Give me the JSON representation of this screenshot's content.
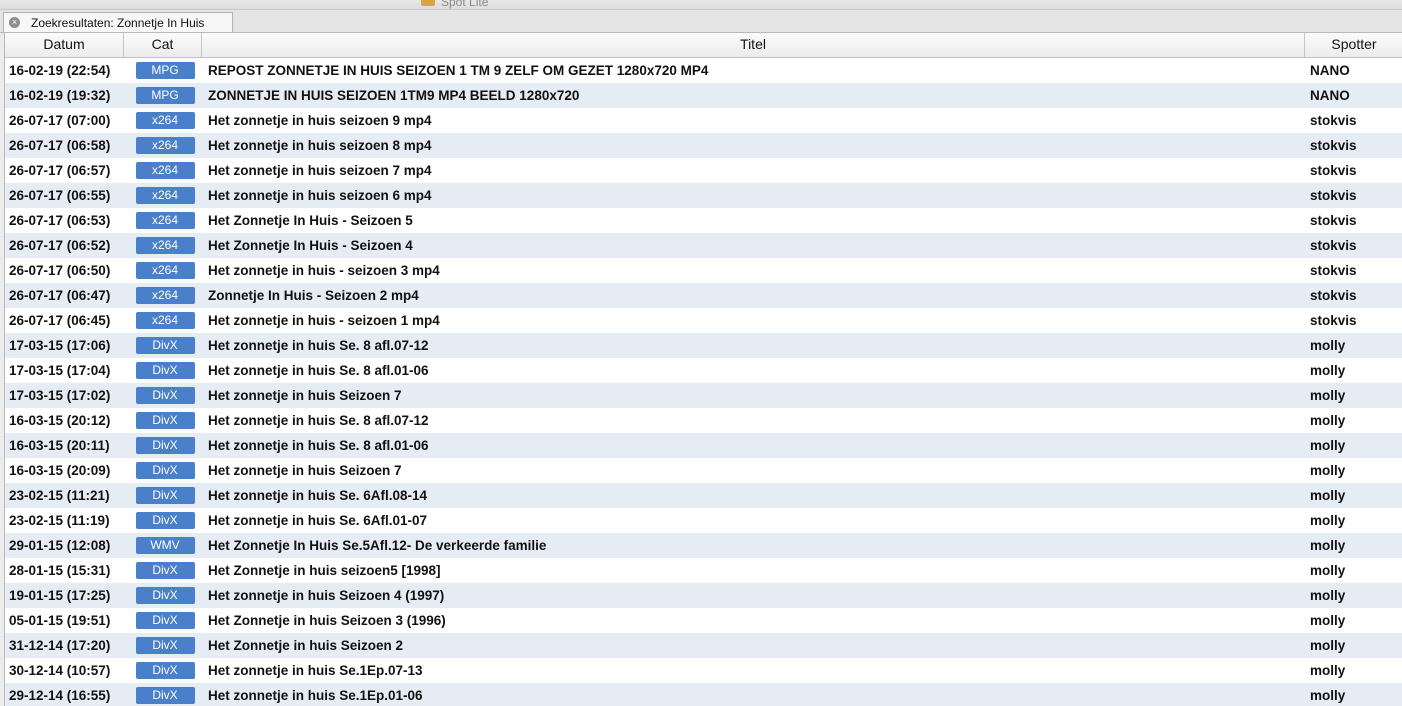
{
  "window": {
    "title": "Spot Lite"
  },
  "tab": {
    "label": "Zoekresultaten: Zonnetje In Huis"
  },
  "columns": {
    "datum": "Datum",
    "cat": "Cat",
    "titel": "Titel",
    "spotter": "Spotter"
  },
  "rows": [
    {
      "datum": "16-02-19 (22:54)",
      "cat": "MPG",
      "titel": "REPOST ZONNETJE IN HUIS SEIZOEN 1 TM 9 ZELF OM GEZET 1280x720 MP4",
      "spotter": "NANO"
    },
    {
      "datum": "16-02-19 (19:32)",
      "cat": "MPG",
      "titel": "ZONNETJE IN HUIS SEIZOEN 1TM9 MP4 BEELD 1280x720",
      "spotter": "NANO"
    },
    {
      "datum": "26-07-17 (07:00)",
      "cat": "x264",
      "titel": "Het zonnetje in huis seizoen 9 mp4",
      "spotter": "stokvis"
    },
    {
      "datum": "26-07-17 (06:58)",
      "cat": "x264",
      "titel": "Het zonnetje in huis seizoen 8 mp4",
      "spotter": "stokvis"
    },
    {
      "datum": "26-07-17 (06:57)",
      "cat": "x264",
      "titel": "Het zonnetje in huis seizoen 7 mp4",
      "spotter": "stokvis"
    },
    {
      "datum": "26-07-17 (06:55)",
      "cat": "x264",
      "titel": "Het zonnetje in huis seizoen 6 mp4",
      "spotter": "stokvis"
    },
    {
      "datum": "26-07-17 (06:53)",
      "cat": "x264",
      "titel": "Het Zonnetje In Huis - Seizoen 5",
      "spotter": "stokvis"
    },
    {
      "datum": "26-07-17 (06:52)",
      "cat": "x264",
      "titel": "Het Zonnetje In Huis - Seizoen 4",
      "spotter": "stokvis"
    },
    {
      "datum": "26-07-17 (06:50)",
      "cat": "x264",
      "titel": "Het zonnetje in huis - seizoen 3 mp4",
      "spotter": "stokvis"
    },
    {
      "datum": "26-07-17 (06:47)",
      "cat": "x264",
      "titel": "Zonnetje In Huis - Seizoen 2 mp4",
      "spotter": "stokvis"
    },
    {
      "datum": "26-07-17 (06:45)",
      "cat": "x264",
      "titel": "Het zonnetje in huis - seizoen 1 mp4",
      "spotter": "stokvis"
    },
    {
      "datum": "17-03-15 (17:06)",
      "cat": "DivX",
      "titel": "Het zonnetje in huis Se. 8 afl.07-12",
      "spotter": "molly"
    },
    {
      "datum": "17-03-15 (17:04)",
      "cat": "DivX",
      "titel": "Het zonnetje in huis Se. 8 afl.01-06",
      "spotter": "molly"
    },
    {
      "datum": "17-03-15 (17:02)",
      "cat": "DivX",
      "titel": "Het zonnetje in huis Seizoen 7",
      "spotter": "molly"
    },
    {
      "datum": "16-03-15 (20:12)",
      "cat": "DivX",
      "titel": "Het zonnetje in huis Se. 8 afl.07-12",
      "spotter": "molly"
    },
    {
      "datum": "16-03-15 (20:11)",
      "cat": "DivX",
      "titel": "Het zonnetje in huis Se. 8 afl.01-06",
      "spotter": "molly"
    },
    {
      "datum": "16-03-15 (20:09)",
      "cat": "DivX",
      "titel": "Het zonnetje in huis Seizoen 7",
      "spotter": "molly"
    },
    {
      "datum": "23-02-15 (11:21)",
      "cat": "DivX",
      "titel": "Het zonnetje in huis Se. 6Afl.08-14",
      "spotter": "molly"
    },
    {
      "datum": "23-02-15 (11:19)",
      "cat": "DivX",
      "titel": "Het zonnetje in huis Se. 6Afl.01-07",
      "spotter": "molly"
    },
    {
      "datum": "29-01-15 (12:08)",
      "cat": "WMV",
      "titel": "Het Zonnetje In Huis Se.5Afl.12- De verkeerde familie",
      "spotter": "molly"
    },
    {
      "datum": "28-01-15 (15:31)",
      "cat": "DivX",
      "titel": "Het Zonnetje in huis seizoen5 [1998]",
      "spotter": "molly"
    },
    {
      "datum": "19-01-15 (17:25)",
      "cat": "DivX",
      "titel": "Het zonnetje in huis Seizoen 4 (1997)",
      "spotter": "molly"
    },
    {
      "datum": "05-01-15 (19:51)",
      "cat": "DivX",
      "titel": "Het Zonnetje in huis Seizoen 3 (1996)",
      "spotter": "molly"
    },
    {
      "datum": "31-12-14 (17:20)",
      "cat": "DivX",
      "titel": "Het Zonnetje in huis Seizoen 2",
      "spotter": "molly"
    },
    {
      "datum": "30-12-14 (10:57)",
      "cat": "DivX",
      "titel": "Het zonnetje in huis Se.1Ep.07-13",
      "spotter": "molly"
    },
    {
      "datum": "29-12-14 (16:55)",
      "cat": "DivX",
      "titel": "Het zonnetje in huis Se.1Ep.01-06",
      "spotter": "molly"
    }
  ],
  "colors": {
    "badge": "#4a7fc9",
    "row_alt": "#e6ecf4"
  },
  "icons": {
    "tab_close": "close-icon",
    "app": "app-icon"
  }
}
